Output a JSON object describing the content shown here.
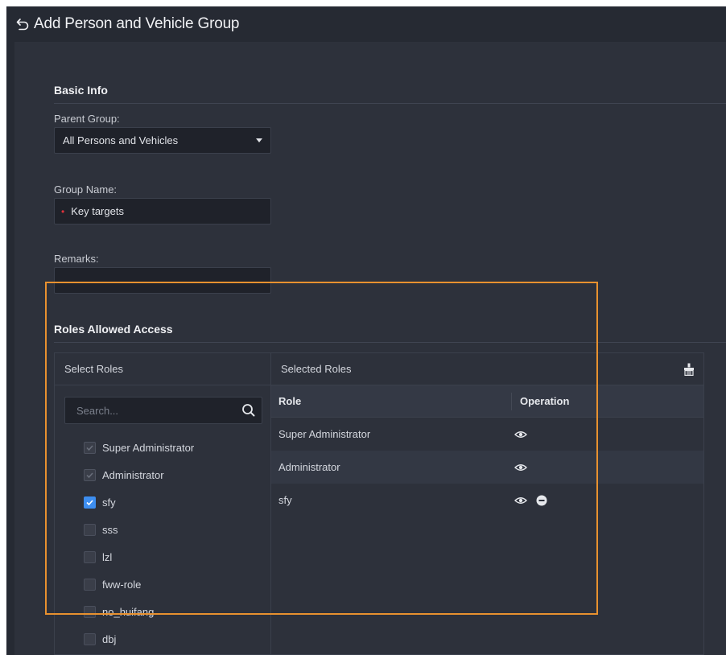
{
  "header": {
    "title": "Add Person and Vehicle Group",
    "back_icon": "back-arrow-icon"
  },
  "basic_info": {
    "title": "Basic Info",
    "parent_group": {
      "label": "Parent Group:",
      "value": "All Persons and Vehicles"
    },
    "group_name": {
      "label": "Group Name:",
      "value": "Key targets",
      "required": true
    },
    "remarks": {
      "label": "Remarks:",
      "value": ""
    }
  },
  "roles": {
    "title": "Roles Allowed Access",
    "select_roles_label": "Select Roles",
    "selected_roles_label": "Selected Roles",
    "search_placeholder": "Search...",
    "available": [
      {
        "label": "Super Administrator",
        "state": "checked-disabled"
      },
      {
        "label": "Administrator",
        "state": "checked-disabled"
      },
      {
        "label": "sfy",
        "state": "checked"
      },
      {
        "label": "sss",
        "state": "unchecked"
      },
      {
        "label": "lzl",
        "state": "unchecked"
      },
      {
        "label": "fww-role",
        "state": "unchecked"
      },
      {
        "label": "no_huifang",
        "state": "unchecked"
      },
      {
        "label": "dbj",
        "state": "unchecked"
      }
    ],
    "table": {
      "col_role": "Role",
      "col_operation": "Operation",
      "rows": [
        {
          "role": "Super Administrator",
          "removable": false
        },
        {
          "role": "Administrator",
          "removable": false
        },
        {
          "role": "sfy",
          "removable": true
        }
      ]
    }
  },
  "colors": {
    "accent": "#3d8ef0",
    "highlight": "#e8912f",
    "required": "#e0323b",
    "background": "#2d313b"
  }
}
